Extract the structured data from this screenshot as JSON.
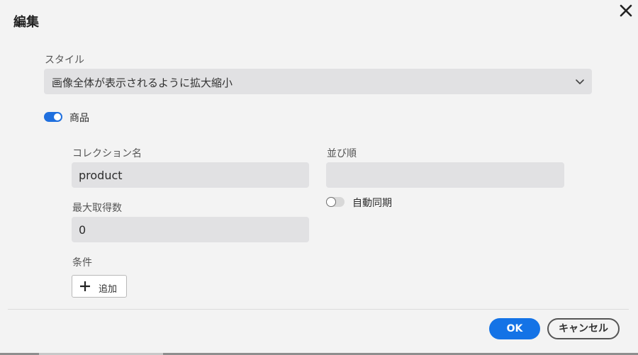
{
  "dialog": {
    "title": "編集",
    "close_icon": "close-icon"
  },
  "style_field": {
    "label": "スタイル",
    "selected": "画像全体が表示されるように拡大縮小",
    "icon": "chevron-down-icon"
  },
  "product_toggle": {
    "label": "商品",
    "checked": true
  },
  "collection_name": {
    "label": "コレクション名",
    "value": "product"
  },
  "sort_order": {
    "label": "並び順",
    "value": ""
  },
  "auto_sync": {
    "label": "自動同期",
    "checked": false
  },
  "max_fetch": {
    "label": "最大取得数",
    "value": "0"
  },
  "conditions": {
    "label": "条件",
    "add_label": "追加",
    "add_icon": "plus-icon"
  },
  "footer": {
    "ok_label": "OK",
    "cancel_label": "キャンセル"
  },
  "colors": {
    "accent": "#1473e6",
    "toggle_on": "#1f6fde",
    "field_bg": "#e1e1e3",
    "dialog_bg": "#f3f3f3"
  }
}
